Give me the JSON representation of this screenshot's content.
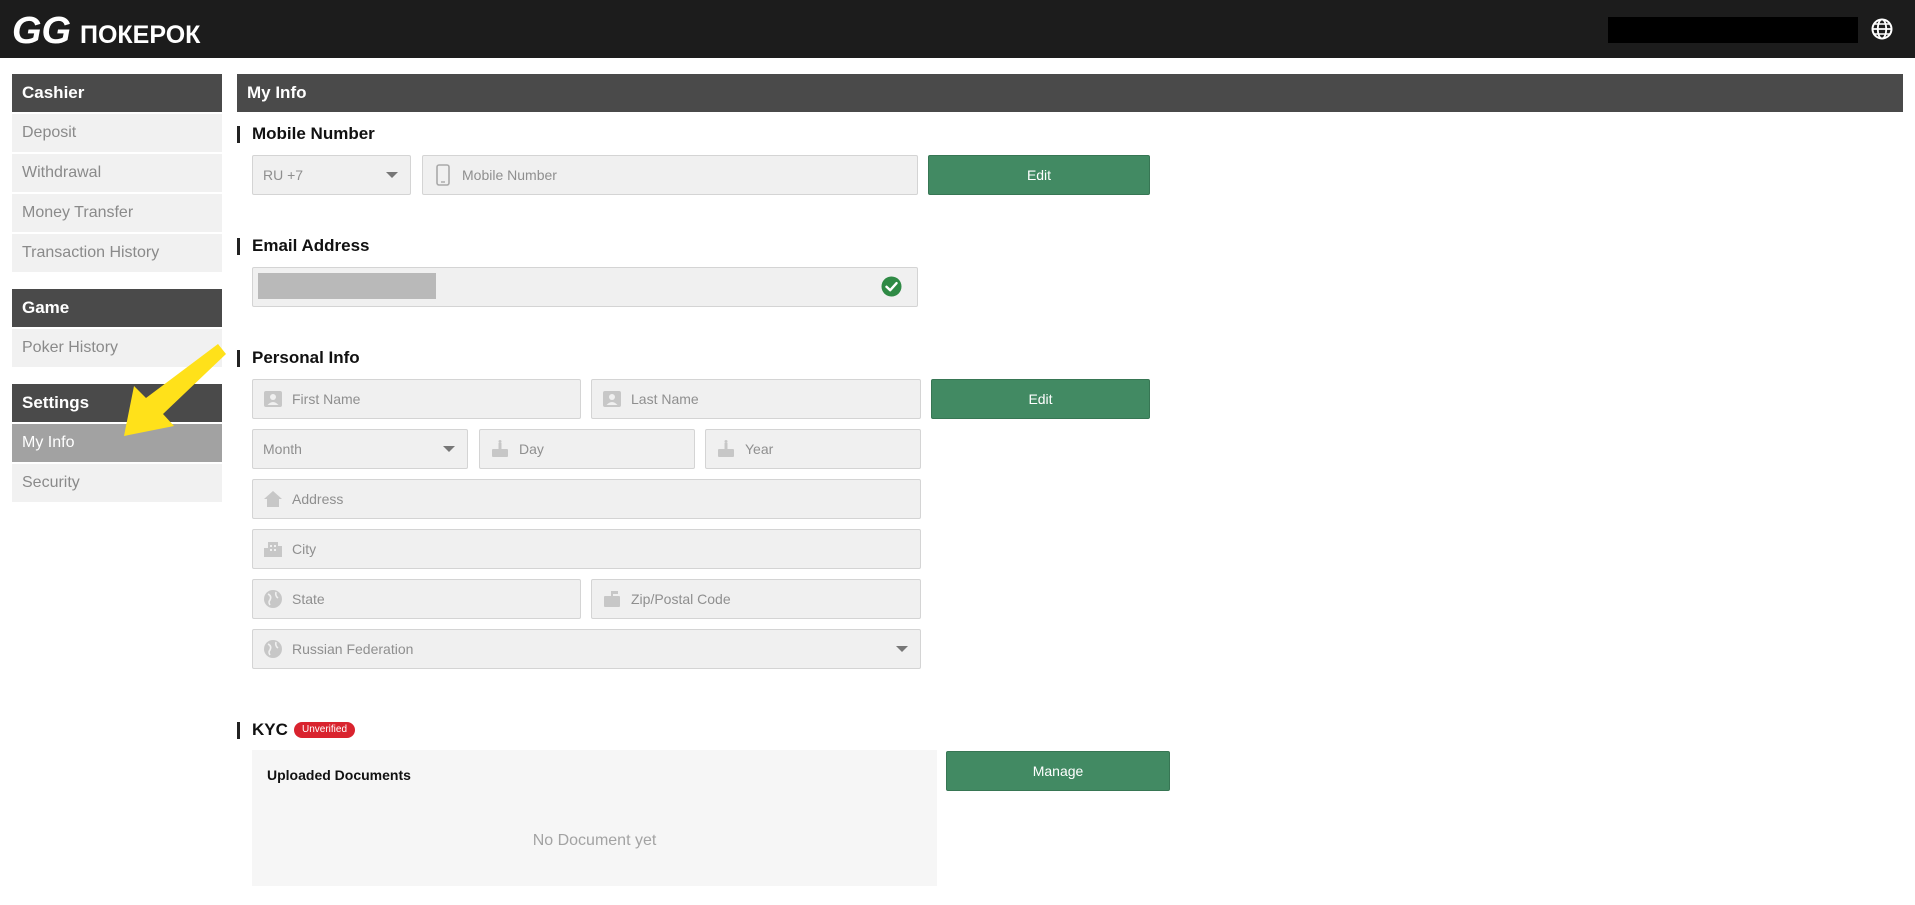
{
  "header": {
    "logo_gg": "GG",
    "logo_text": "ПОКЕРОК",
    "icons": {
      "globe": "globe-icon"
    }
  },
  "sidebar": {
    "groups": [
      {
        "title": "Cashier",
        "items": [
          "Deposit",
          "Withdrawal",
          "Money Transfer",
          "Transaction History"
        ]
      },
      {
        "title": "Game",
        "items": [
          "Poker History"
        ]
      },
      {
        "title": "Settings",
        "items": [
          "My Info",
          "Security"
        ]
      }
    ],
    "active_item": "My Info"
  },
  "main": {
    "title": "My Info",
    "mobile": {
      "title": "Mobile Number",
      "country_code": "RU +7",
      "placeholder": "Mobile Number",
      "edit_label": "Edit",
      "icons": {
        "phone": "phone-icon"
      }
    },
    "email": {
      "title": "Email Address",
      "verified": true,
      "icons": {
        "verified": "check-circle-icon"
      }
    },
    "personal": {
      "title": "Personal Info",
      "first_name": "First Name",
      "last_name": "Last Name",
      "month": "Month",
      "day": "Day",
      "year": "Year",
      "address": "Address",
      "city": "City",
      "state": "State",
      "zip": "Zip/Postal Code",
      "country": "Russian Federation",
      "edit_label": "Edit"
    },
    "kyc": {
      "title": "KYC",
      "status": "Unverified",
      "docs_title": "Uploaded Documents",
      "docs_empty": "No Document yet",
      "manage_label": "Manage"
    }
  },
  "colors": {
    "header_bg": "#1c1c1c",
    "section_head_bg": "#4a4a4a",
    "button_green": "#428a63",
    "badge_red": "#d9232e",
    "active_item_bg": "#a2a2a2",
    "arrow_yellow": "#ffe11a"
  }
}
